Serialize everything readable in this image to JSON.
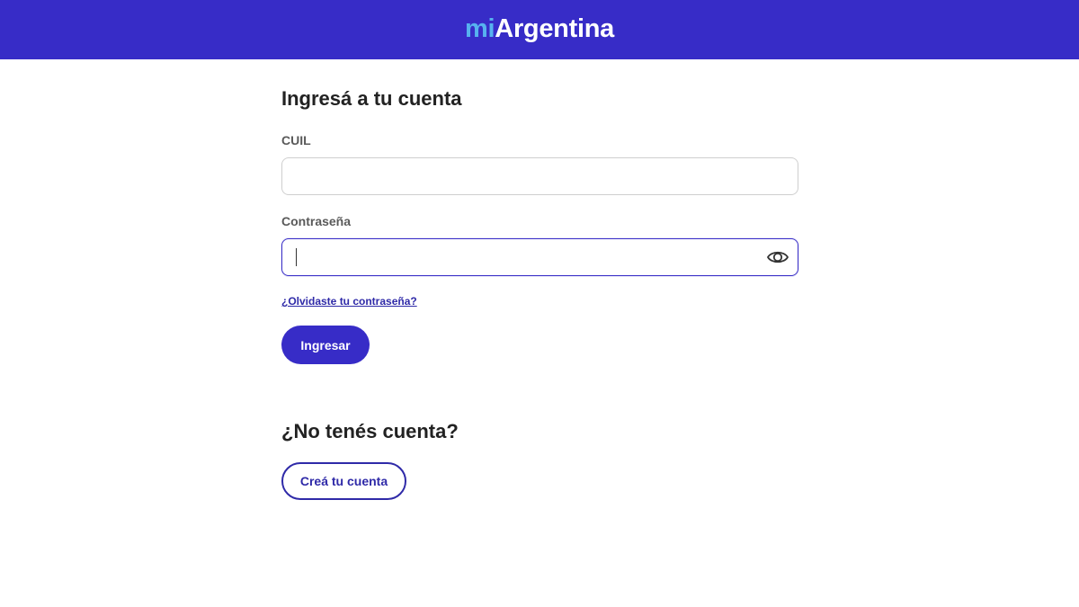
{
  "header": {
    "logo_prefix": "mi",
    "logo_main": "Argentina",
    "background_color": "#372cc7",
    "logo_prefix_color": "#57b2ef"
  },
  "login": {
    "title": "Ingresá a tu cuenta",
    "cuil_label": "CUIL",
    "cuil_value": "",
    "password_label": "Contraseña",
    "password_value": "",
    "show_password_icon": "eye-icon",
    "forgot_password_link": "¿Olvidaste tu contraseña?",
    "submit_label": "Ingresar",
    "accent_color": "#372cc7"
  },
  "signup": {
    "title": "¿No tenés cuenta?",
    "create_label": "Creá tu cuenta"
  }
}
